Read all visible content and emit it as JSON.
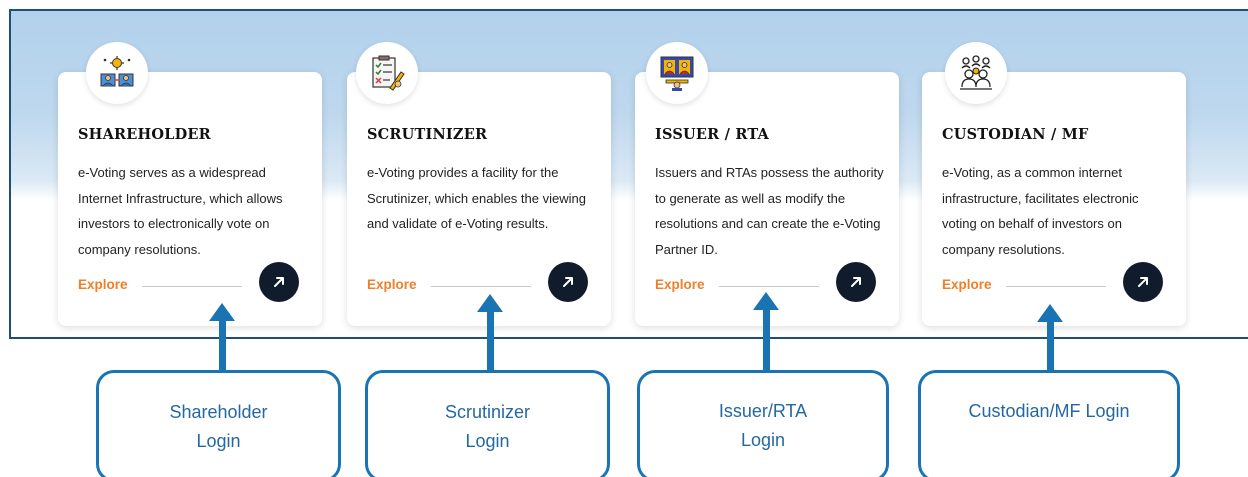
{
  "cards": [
    {
      "title": "SHAREHOLDER",
      "description": "e-Voting serves as a widespread Internet Infrastructure, which allows investors to electronically vote on company resolutions.",
      "explore_label": "Explore",
      "icon": "shareholder-voting-icon"
    },
    {
      "title": "SCRUTINIZER",
      "description": "e-Voting provides a facility for the Scrutinizer, which enables the viewing and validate of e-Voting results.",
      "explore_label": "Explore",
      "icon": "scrutinizer-checklist-icon"
    },
    {
      "title": "ISSUER / RTA",
      "description": "Issuers and RTAs possess the authority to generate as well as modify the resolutions and can create the e-Voting Partner ID.",
      "explore_label": "Explore",
      "icon": "issuer-meeting-icon"
    },
    {
      "title": "CUSTODIAN / MF",
      "description": "e-Voting, as a common internet infrastructure, facilitates electronic voting on behalf of investors on company resolutions.",
      "explore_label": "Explore",
      "icon": "custodian-group-icon"
    }
  ],
  "go_icon": "arrow-up-right-icon",
  "callouts": [
    {
      "label": "Shareholder\nLogin"
    },
    {
      "label": "Scrutinizer\nLogin"
    },
    {
      "label": "Issuer/RTA\nLogin"
    },
    {
      "label": "Custodian/MF Login"
    }
  ],
  "colors": {
    "explore": "#ef7f28",
    "go_button": "#101c2c",
    "callout_border": "#1a74b3",
    "callout_text": "#2468a3",
    "panel_border": "#1d4f7a"
  }
}
